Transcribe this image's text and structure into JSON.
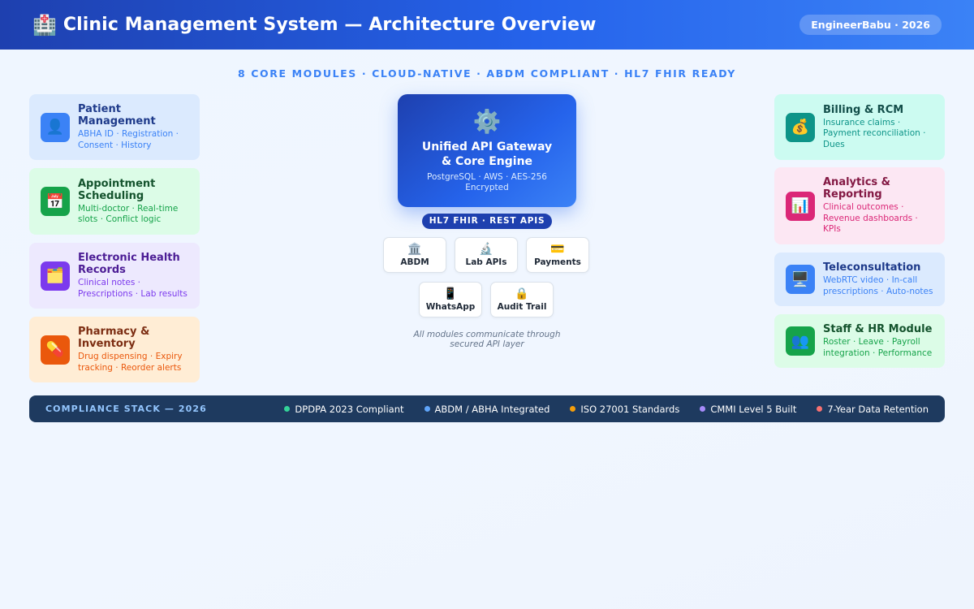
{
  "header": {
    "icon": "hospital-icon",
    "icon_glyph": "🏥",
    "title": "Clinic Management System — Architecture Overview",
    "badge": "EngineerBabu · 2026"
  },
  "subtitle": "8 CORE MODULES · CLOUD-NATIVE · ABDM COMPLIANT · HL7 FHIR READY",
  "left_modules": [
    {
      "title": "Patient Management",
      "desc": "ABHA ID · Registration · Consent · History",
      "icon": "person-icon",
      "glyph": "👤",
      "bg": "#dbeafe",
      "icon_bg": "#3b82f6",
      "title_color": "#1e3a8a",
      "desc_color": "#3b82f6"
    },
    {
      "title": "Appointment Scheduling",
      "desc": "Multi-doctor · Real-time slots · Conflict logic",
      "icon": "calendar-icon",
      "glyph": "📅",
      "bg": "#dcfce7",
      "icon_bg": "#16a34a",
      "title_color": "#14532d",
      "desc_color": "#16a34a"
    },
    {
      "title": "Electronic Health Records",
      "desc": "Clinical notes · Prescriptions · Lab results",
      "icon": "folder-icon",
      "glyph": "🗂️",
      "bg": "#ede9fe",
      "icon_bg": "#7c3aed",
      "title_color": "#4c1d95",
      "desc_color": "#7c3aed"
    },
    {
      "title": "Pharmacy & Inventory",
      "desc": "Drug dispensing · Expiry tracking · Reorder alerts",
      "icon": "pill-icon",
      "glyph": "💊",
      "bg": "#ffedd5",
      "icon_bg": "#ea580c",
      "title_color": "#7c2d12",
      "desc_color": "#ea580c"
    }
  ],
  "right_modules": [
    {
      "title": "Billing & RCM",
      "desc": "Insurance claims · Payment reconciliation · Dues",
      "icon": "money-bag-icon",
      "glyph": "💰",
      "bg": "#ccfbf1",
      "icon_bg": "#0d9488",
      "title_color": "#134e4a",
      "desc_color": "#0d9488"
    },
    {
      "title": "Analytics & Reporting",
      "desc": "Clinical outcomes · Revenue dashboards · KPIs",
      "icon": "bar-chart-icon",
      "glyph": "📊",
      "bg": "#fce7f3",
      "icon_bg": "#db2777",
      "title_color": "#831843",
      "desc_color": "#db2777"
    },
    {
      "title": "Teleconsultation",
      "desc": "WebRTC video · In-call prescriptions · Auto-notes",
      "icon": "monitor-icon",
      "glyph": "🖥️",
      "bg": "#dbeafe",
      "icon_bg": "#3b82f6",
      "title_color": "#1e3a8a",
      "desc_color": "#3b82f6"
    },
    {
      "title": "Staff & HR Module",
      "desc": "Roster · Leave · Payroll integration · Performance",
      "icon": "people-icon",
      "glyph": "👥",
      "bg": "#dcfce7",
      "icon_bg": "#16a34a",
      "title_color": "#14532d",
      "desc_color": "#16a34a"
    }
  ],
  "gateway": {
    "icon": "gear-icon",
    "glyph": "⚙️",
    "title_line1": "Unified API Gateway",
    "title_line2": "& Core Engine",
    "subtitle": "PostgreSQL · AWS · AES-256 Encrypted"
  },
  "api_pill": "HL7 FHIR · REST APIS",
  "integrations": [
    {
      "label": "ABDM",
      "icon": "bank-icon",
      "glyph": "🏛️"
    },
    {
      "label": "Lab APIs",
      "icon": "microscope-icon",
      "glyph": "🔬"
    },
    {
      "label": "Payments",
      "icon": "credit-card-icon",
      "glyph": "💳"
    },
    {
      "label": "WhatsApp",
      "icon": "mobile-phone-icon",
      "glyph": "📱"
    },
    {
      "label": "Audit Trail",
      "icon": "lock-icon",
      "glyph": "🔒"
    }
  ],
  "note": "All modules communicate through secured API layer",
  "compliance": {
    "title": "COMPLIANCE STACK — 2026",
    "items": [
      {
        "label": "DPDPA 2023 Compliant",
        "color": "#34d399"
      },
      {
        "label": "ABDM / ABHA Integrated",
        "color": "#60a5fa"
      },
      {
        "label": "ISO 27001 Standards",
        "color": "#f59e0b"
      },
      {
        "label": "CMMI Level 5 Built",
        "color": "#a78bfa"
      },
      {
        "label": "7-Year Data Retention",
        "color": "#f87171"
      }
    ]
  }
}
